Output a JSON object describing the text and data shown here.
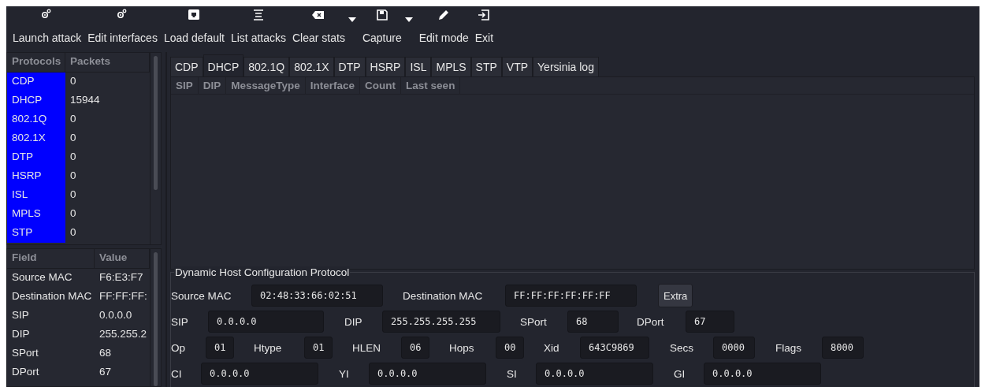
{
  "toolbar": [
    {
      "label": "Launch attack",
      "menu": false
    },
    {
      "label": "Edit interfaces",
      "menu": false
    },
    {
      "label": "Load default",
      "menu": false
    },
    {
      "label": "List attacks",
      "menu": false
    },
    {
      "label": "Clear stats",
      "menu": true
    },
    {
      "label": "Capture",
      "menu": true
    },
    {
      "label": "Edit mode",
      "menu": false
    },
    {
      "label": "Exit",
      "menu": false
    }
  ],
  "protocols_table": {
    "columns": [
      "Protocols",
      "Packets"
    ],
    "rows": [
      [
        "CDP",
        "0"
      ],
      [
        "DHCP",
        "15944"
      ],
      [
        "802.1Q",
        "0"
      ],
      [
        "802.1X",
        "0"
      ],
      [
        "DTP",
        "0"
      ],
      [
        "HSRP",
        "0"
      ],
      [
        "ISL",
        "0"
      ],
      [
        "MPLS",
        "0"
      ],
      [
        "STP",
        "0"
      ]
    ]
  },
  "fields_table": {
    "columns": [
      "Field",
      "Value"
    ],
    "rows": [
      [
        "Source MAC",
        "F6:E3:F7"
      ],
      [
        "Destination MAC",
        "FF:FF:FF:"
      ],
      [
        "SIP",
        "0.0.0.0"
      ],
      [
        "DIP",
        "255.255.2"
      ],
      [
        "SPort",
        "68"
      ],
      [
        "DPort",
        "67"
      ]
    ]
  },
  "tabs": [
    {
      "label": "CDP",
      "selected": false
    },
    {
      "label": "DHCP",
      "selected": true
    },
    {
      "label": "802.1Q",
      "selected": false
    },
    {
      "label": "802.1X",
      "selected": false
    },
    {
      "label": "DTP",
      "selected": false
    },
    {
      "label": "HSRP",
      "selected": false
    },
    {
      "label": "ISL",
      "selected": false
    },
    {
      "label": "MPLS",
      "selected": false
    },
    {
      "label": "STP",
      "selected": false
    },
    {
      "label": "VTP",
      "selected": false
    },
    {
      "label": "Yersinia log",
      "selected": false
    }
  ],
  "packet_table": {
    "columns": [
      "SIP",
      "DIP",
      "MessageType",
      "Interface",
      "Count",
      "Last seen"
    ]
  },
  "form": {
    "title": "Dynamic Host Configuration Protocol",
    "lines": [
      {
        "items": [
          {
            "kind": "field",
            "label": "Source MAC",
            "value": "02:48:33:66:02:51"
          },
          {
            "kind": "field",
            "label": "Destination MAC",
            "value": "FF:FF:FF:FF:FF:FF"
          },
          {
            "kind": "button",
            "label": "Extra"
          }
        ]
      },
      {
        "items": [
          {
            "kind": "field",
            "label": "SIP",
            "value": "0.0.0.0"
          },
          {
            "kind": "field",
            "label": "DIP",
            "value": "255.255.255.255"
          },
          {
            "kind": "field",
            "label": "SPort",
            "value": "68"
          },
          {
            "kind": "field",
            "label": "DPort",
            "value": "67"
          }
        ]
      },
      {
        "items": [
          {
            "kind": "field",
            "label": "Op",
            "value": "01"
          },
          {
            "kind": "field",
            "label": "Htype",
            "value": "01"
          },
          {
            "kind": "field",
            "label": "HLEN",
            "value": "06"
          },
          {
            "kind": "field",
            "label": "Hops",
            "value": "00"
          },
          {
            "kind": "field",
            "label": "Xid",
            "value": "643C9869"
          },
          {
            "kind": "field",
            "label": "Secs",
            "value": "0000"
          },
          {
            "kind": "field",
            "label": "Flags",
            "value": "8000"
          }
        ]
      },
      {
        "items": [
          {
            "kind": "field",
            "label": "CI",
            "value": "0.0.0.0"
          },
          {
            "kind": "field",
            "label": "YI",
            "value": "0.0.0.0"
          },
          {
            "kind": "field",
            "label": "SI",
            "value": "0.0.0.0"
          },
          {
            "kind": "field",
            "label": "GI",
            "value": "0.0.0.0"
          }
        ]
      }
    ]
  }
}
